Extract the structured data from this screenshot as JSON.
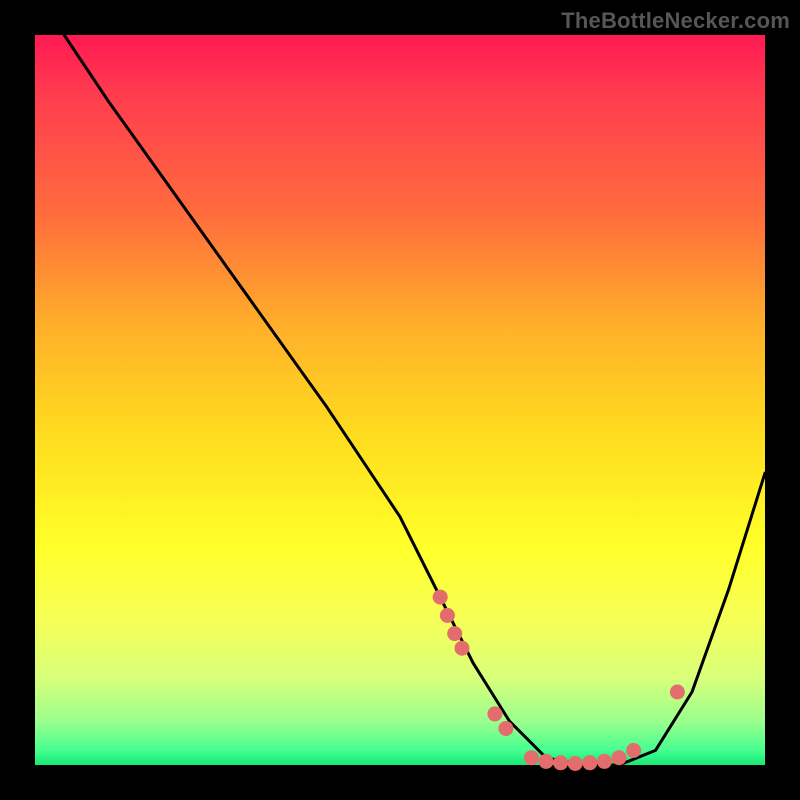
{
  "watermark": "TheBottleNecker.com",
  "chart_data": {
    "type": "line",
    "title": "",
    "xlabel": "",
    "ylabel": "",
    "xlim": [
      0,
      100
    ],
    "ylim": [
      0,
      100
    ],
    "curve": {
      "x": [
        4,
        10,
        20,
        30,
        40,
        50,
        55,
        60,
        65,
        70,
        75,
        80,
        85,
        90,
        95,
        100
      ],
      "y": [
        100,
        91,
        77,
        63,
        49,
        34,
        24,
        14,
        6,
        1,
        0,
        0,
        2,
        10,
        24,
        40
      ]
    },
    "markers": [
      {
        "x": 55.5,
        "y": 23.0
      },
      {
        "x": 56.5,
        "y": 20.5
      },
      {
        "x": 57.5,
        "y": 18.0
      },
      {
        "x": 58.5,
        "y": 16.0
      },
      {
        "x": 63.0,
        "y": 7.0
      },
      {
        "x": 64.5,
        "y": 5.0
      },
      {
        "x": 68.0,
        "y": 1.0
      },
      {
        "x": 70.0,
        "y": 0.5
      },
      {
        "x": 72.0,
        "y": 0.3
      },
      {
        "x": 74.0,
        "y": 0.2
      },
      {
        "x": 76.0,
        "y": 0.3
      },
      {
        "x": 78.0,
        "y": 0.5
      },
      {
        "x": 80.0,
        "y": 1.0
      },
      {
        "x": 82.0,
        "y": 2.0
      },
      {
        "x": 88.0,
        "y": 10.0
      }
    ],
    "marker_color": "#e36d6d",
    "curve_color": "#000000"
  }
}
